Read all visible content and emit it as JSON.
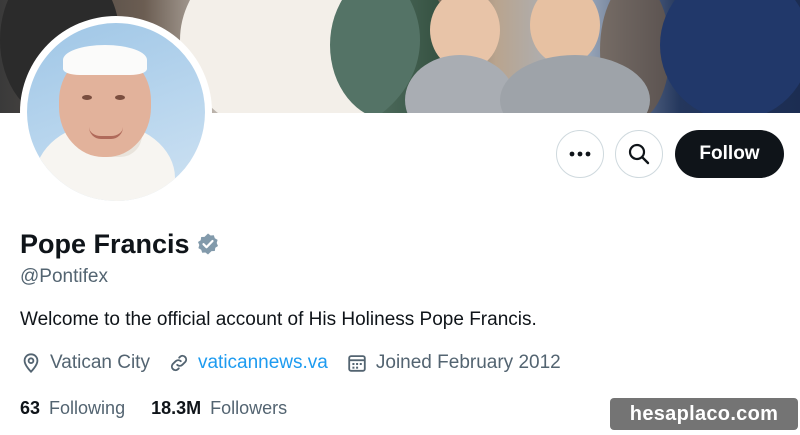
{
  "profile": {
    "name": "Pope Francis",
    "handle": "@Pontifex",
    "bio": "Welcome to the official account of His Holiness Pope Francis.",
    "location": "Vatican City",
    "website": "vaticannews.va",
    "joined": "Joined February 2012",
    "verified_icon": "verified-badge-icon",
    "verified_color": "#829aab"
  },
  "actions": {
    "more_icon": "more-options-icon",
    "search_icon": "search-icon",
    "follow_label": "Follow"
  },
  "stats": {
    "following_count": "63",
    "following_label": "Following",
    "followers_count": "18.3M",
    "followers_label": "Followers"
  },
  "watermark": "hesaplaco.com",
  "colors": {
    "accent": "#1d9bf0",
    "text_primary": "#0f1419",
    "text_secondary": "#536471",
    "follow_bg": "#0f1419"
  }
}
